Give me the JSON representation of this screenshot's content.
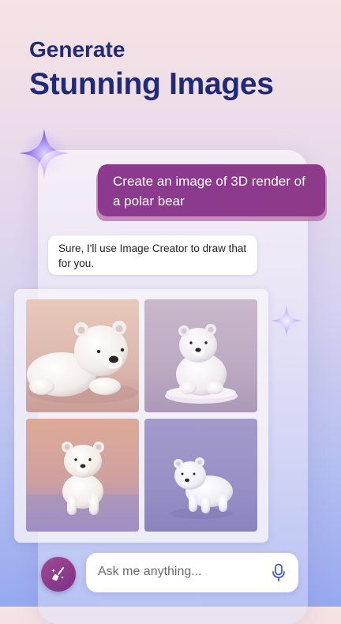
{
  "headline": {
    "line1": "Generate",
    "line2": "Stunning Images"
  },
  "chat": {
    "user_message": "Create an image of 3D render of a polar bear",
    "bot_message": "Sure, I'll use Image Creator to draw that for you."
  },
  "images": [
    {
      "alt": "polar-bear-render-1"
    },
    {
      "alt": "polar-bear-render-2"
    },
    {
      "alt": "polar-bear-render-3"
    },
    {
      "alt": "polar-bear-render-4"
    }
  ],
  "composer": {
    "placeholder": "Ask me anything...",
    "left_button_icon": "broom-sparkle-icon",
    "mic_icon": "microphone-icon"
  },
  "colors": {
    "headline": "#1f2a7a",
    "user_bubble": "#8b3a8f",
    "accent": "#7b2f86"
  }
}
